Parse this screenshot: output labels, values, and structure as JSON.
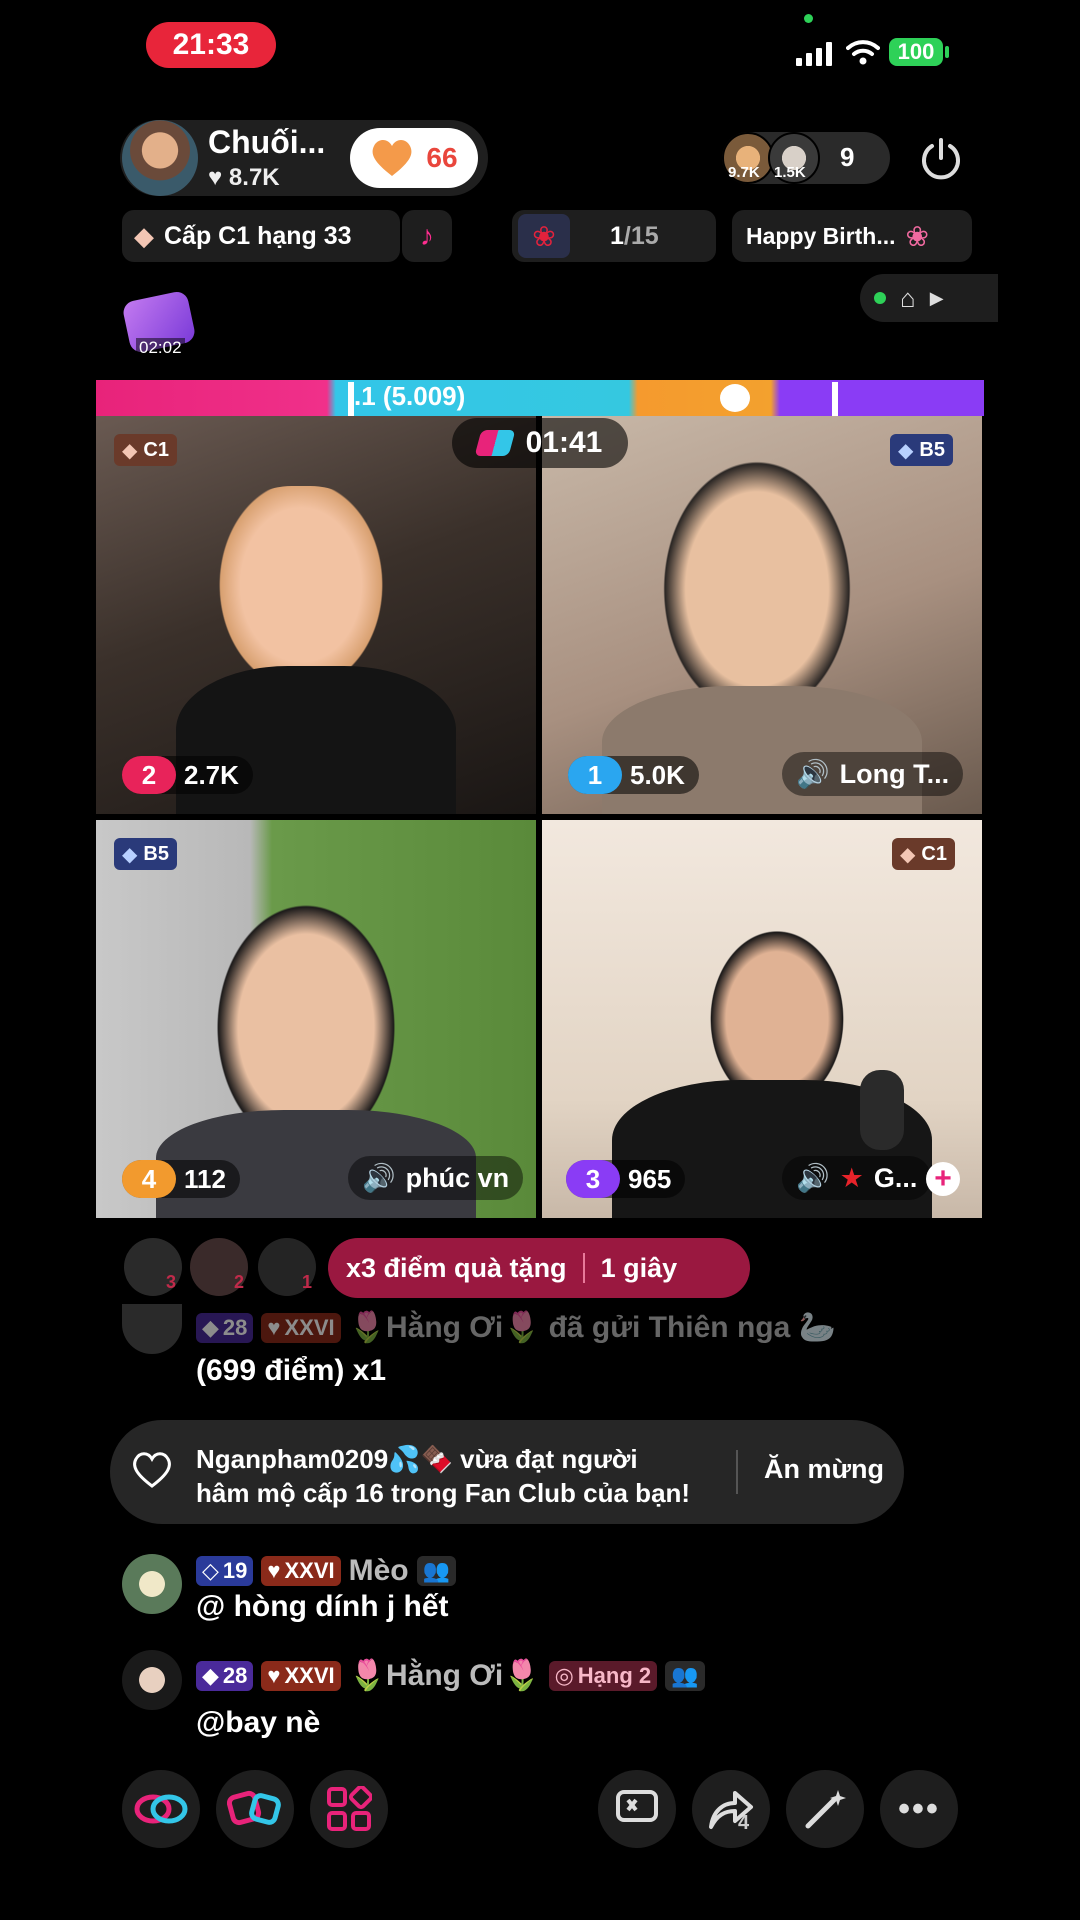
{
  "status": {
    "time": "21:33",
    "battery": "100"
  },
  "host": {
    "name": "Chuối...",
    "likes": "8.7K",
    "follow_count": "66"
  },
  "viewers": {
    "v1_badge": "9.7K",
    "v2_badge": "1.5K",
    "count": "9"
  },
  "chips": {
    "level": "Cấp C1 hạng 33",
    "gift_progress": "1/15",
    "gift_progress_current": "1",
    "gift_progress_total": "/15",
    "event": "Happy Birth..."
  },
  "floating_item": {
    "timer": "02:02"
  },
  "battle": {
    "score_label": ".1 (5.009)",
    "timer": "01:41",
    "tiles": [
      {
        "badge": "C1",
        "rank": "2",
        "score": "2.7K",
        "name": "",
        "rank_color": "#e8235a"
      },
      {
        "badge": "B5",
        "rank": "1",
        "score": "5.0K",
        "name": "Long T...",
        "rank_color": "#2aa6f0"
      },
      {
        "badge": "B5",
        "rank": "4",
        "score": "112",
        "name": "phúc vn",
        "rank_color": "#f29a2e"
      },
      {
        "badge": "C1",
        "rank": "3",
        "score": "965",
        "name": "G...",
        "rank_color": "#8a3cf5"
      }
    ]
  },
  "bonus": {
    "multiplier": "x3 điểm quà tặng",
    "duration": "1 giây",
    "top_ranks": [
      "3",
      "2",
      "1"
    ]
  },
  "chat": {
    "gift_msg": {
      "level": "28",
      "tier": "XXVI",
      "user": "🌷Hằng Ơi🌷",
      "action": "đã gửi Thiên nga 🦢",
      "detail": "(699 điểm) x1"
    },
    "fan_notice": {
      "line1": "Nganpham0209💦🍫 vừa đạt người",
      "line2": "hâm mộ cấp 16 trong Fan Club của bạn!",
      "action": "Ăn mừng"
    },
    "msgs": [
      {
        "level": "19",
        "tier": "XXVI",
        "user": "Mèo",
        "text": "@ hòng dính j hết",
        "rank": ""
      },
      {
        "level": "28",
        "tier": "XXVI",
        "user": "🌷Hằng Ơi🌷",
        "text": "@bay nè",
        "rank": "Hạng 2"
      }
    ]
  },
  "bottom": {
    "share_count": "4"
  }
}
